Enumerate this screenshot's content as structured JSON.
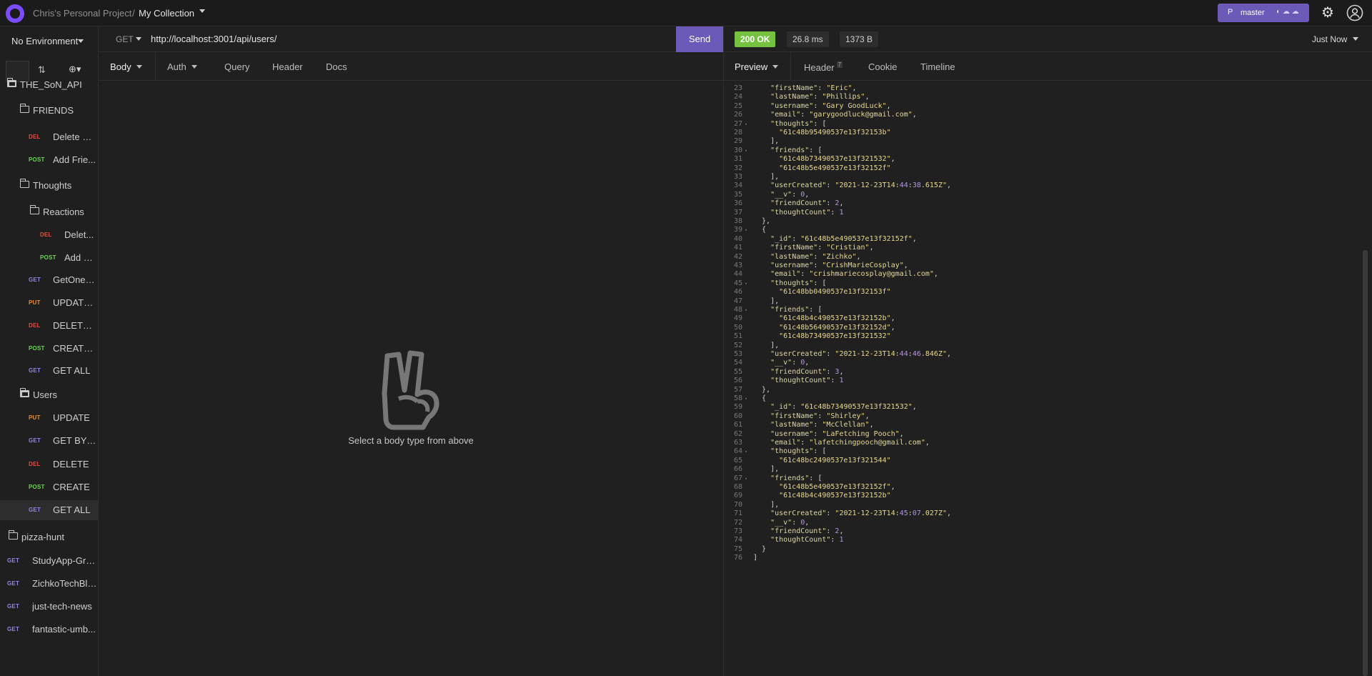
{
  "topbar": {
    "project": "Chris's Personal Project",
    "separator": "/",
    "collection": "My Collection",
    "git_icon": "P",
    "git_branch": "master",
    "git_status_icons": "◐ ☁ ☁"
  },
  "sidebar": {
    "environment": "No Environment",
    "items": [
      {
        "type": "folder",
        "label": "THE_SoN_API",
        "open": true
      },
      {
        "type": "folder",
        "label": "FRIENDS",
        "open": false
      },
      {
        "method": "DEL",
        "label": "Delete Fr..."
      },
      {
        "method": "POST",
        "label": "Add Frie..."
      },
      {
        "type": "folder",
        "label": "Thoughts",
        "open": false
      },
      {
        "type": "folder",
        "label": "Reactions",
        "open": false
      },
      {
        "method": "DEL",
        "label": "Delet..."
      },
      {
        "method": "POST",
        "label": "Add R..."
      },
      {
        "method": "GET",
        "label": "GetOneT..."
      },
      {
        "method": "PUT",
        "label": "UPDATE ..."
      },
      {
        "method": "DEL",
        "label": "DELETE ..."
      },
      {
        "method": "POST",
        "label": "CREATE ..."
      },
      {
        "method": "GET",
        "label": "GET ALL"
      },
      {
        "type": "folder",
        "label": "Users",
        "open": true
      },
      {
        "method": "PUT",
        "label": "UPDATE"
      },
      {
        "method": "GET",
        "label": "GET BY ID"
      },
      {
        "method": "DEL",
        "label": "DELETE"
      },
      {
        "method": "POST",
        "label": "CREATE"
      },
      {
        "method": "GET",
        "label": "GET ALL",
        "active": true
      },
      {
        "type": "folder",
        "label": "pizza-hunt",
        "open": false
      },
      {
        "method": "GET",
        "label": "StudyApp-Gro..."
      },
      {
        "method": "GET",
        "label": "ZichkoTechBlog"
      },
      {
        "method": "GET",
        "label": "just-tech-news"
      },
      {
        "method": "GET",
        "label": "fantastic-umb..."
      }
    ]
  },
  "request": {
    "method": "GET",
    "url": "http://localhost:3001/api/users/",
    "send_label": "Send",
    "tabs": [
      "Body",
      "Auth",
      "Query",
      "Header",
      "Docs"
    ],
    "empty_message": "Select a body type from above"
  },
  "response": {
    "status": "200 OK",
    "time": "26.8 ms",
    "size": "1373 B",
    "history": "Just Now",
    "tabs": [
      "Preview",
      "Header",
      "Cookie",
      "Timeline"
    ],
    "header_count": "7",
    "lines": [
      "    \"firstName\": \"Eric\",",
      "    \"lastName\": \"Phillips\",",
      "    \"username\": \"Gary GoodLuck\",",
      "    \"email\": \"garygoodluck@gmail.com\",",
      "    \"thoughts\": [",
      "      \"61c48b95490537e13f32153b\"",
      "    ],",
      "    \"friends\": [",
      "      \"61c48b73490537e13f321532\",",
      "      \"61c48b5e490537e13f32152f\"",
      "    ],",
      "    \"userCreated\": \"2021-12-23T14:44:38.615Z\",",
      "    \"__v\": 0,",
      "    \"friendCount\": 2,",
      "    \"thoughtCount\": 1",
      "  },",
      "  {",
      "    \"_id\": \"61c48b5e490537e13f32152f\",",
      "    \"firstName\": \"Cristian\",",
      "    \"lastName\": \"Zichko\",",
      "    \"username\": \"CrishMarieCosplay\",",
      "    \"email\": \"crishmariecosplay@gmail.com\",",
      "    \"thoughts\": [",
      "      \"61c48bb0490537e13f32153f\"",
      "    ],",
      "    \"friends\": [",
      "      \"61c48b4c490537e13f32152b\",",
      "      \"61c48b56490537e13f32152d\",",
      "      \"61c48b73490537e13f321532\"",
      "    ],",
      "    \"userCreated\": \"2021-12-23T14:44:46.846Z\",",
      "    \"__v\": 0,",
      "    \"friendCount\": 3,",
      "    \"thoughtCount\": 1",
      "  },",
      "  {",
      "    \"_id\": \"61c48b73490537e13f321532\",",
      "    \"firstName\": \"Shirley\",",
      "    \"lastName\": \"McClellan\",",
      "    \"username\": \"LaFetching Pooch\",",
      "    \"email\": \"lafetchingpooch@gmail.com\",",
      "    \"thoughts\": [",
      "      \"61c48bc2490537e13f321544\"",
      "    ],",
      "    \"friends\": [",
      "      \"61c48b5e490537e13f32152f\",",
      "      \"61c48b4c490537e13f32152b\"",
      "    ],",
      "    \"userCreated\": \"2021-12-23T14:45:07.027Z\",",
      "    \"__v\": 0,",
      "    \"friendCount\": 2,",
      "    \"thoughtCount\": 1",
      "  }",
      "]"
    ],
    "first_line_number": 23,
    "foldable_lines": [
      27,
      30,
      39,
      45,
      48,
      58,
      64,
      67
    ]
  },
  "colors": {
    "accent": "#6c59b8",
    "status_ok": "#74c23f",
    "get": "#8c86e8",
    "post": "#6fd35a",
    "put": "#e89036",
    "del": "#e54e42"
  },
  "icons": {
    "settings": "gear-icon",
    "account": "user-icon",
    "empty_state": "peace-hand-icon"
  }
}
